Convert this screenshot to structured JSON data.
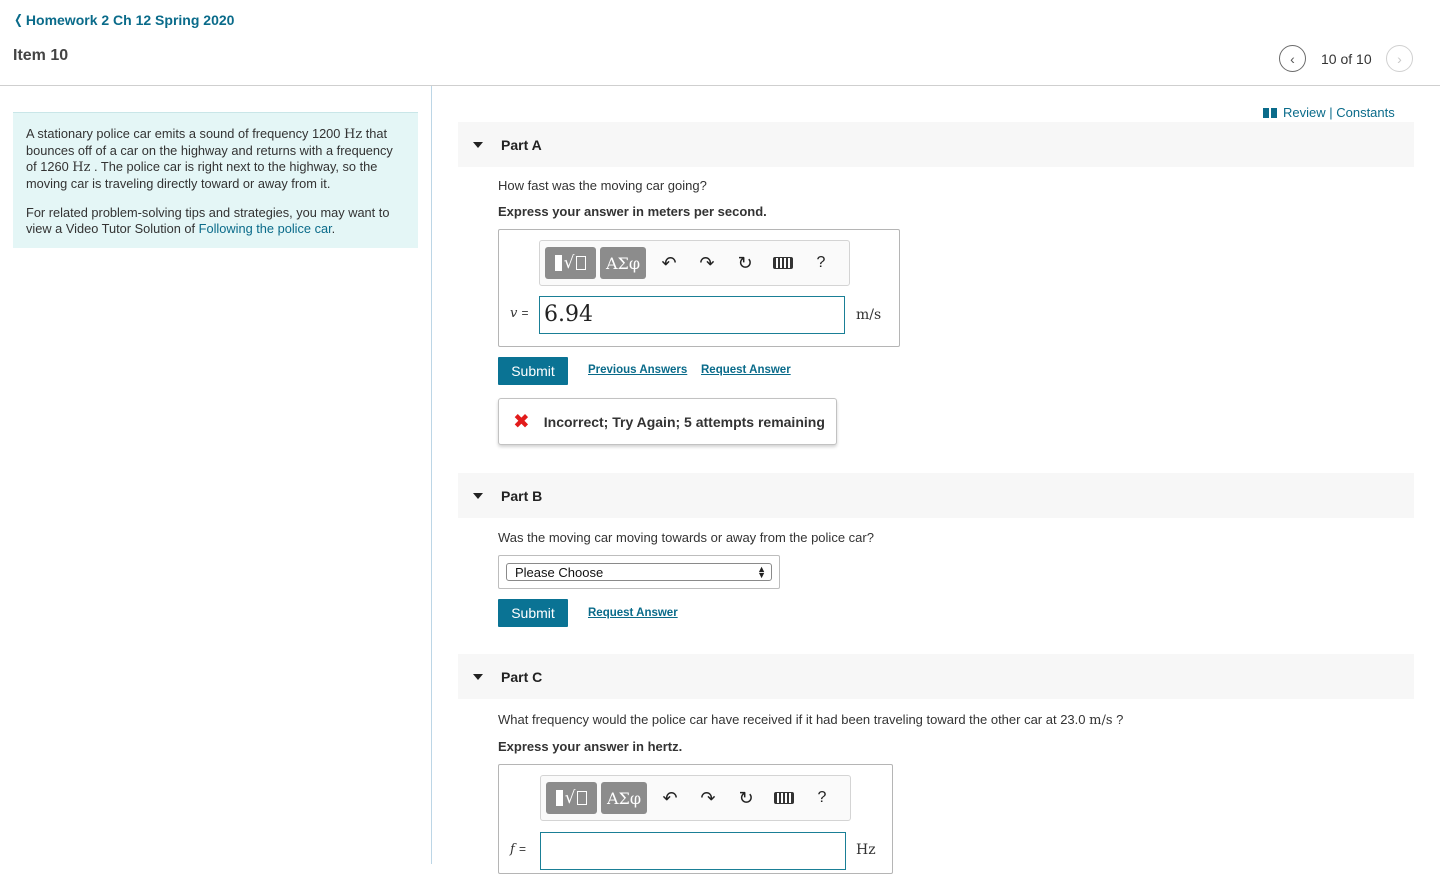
{
  "header": {
    "back_label": "Homework 2 Ch 12 Spring 2020",
    "item_title": "Item 10",
    "position": "10 of 10"
  },
  "intro": {
    "p1_a": "A stationary police car emits a sound of frequency 1200",
    "p1_hz1": "Hz",
    "p1_b": "that bounces off of a car on the highway and returns with a frequency of 1260",
    "p1_hz2": "Hz",
    "p1_c": ". The police car is right next to the highway, so the moving car is traveling directly toward or away from it.",
    "p2_a": "For related problem-solving tips and strategies, you may want to view a Video Tutor Solution of",
    "p2_link": "Following the police car",
    "p2_b": "."
  },
  "review_links": "Review | Constants",
  "toolbar": {
    "greek": "ΑΣφ",
    "help": "?"
  },
  "part_a": {
    "label": "Part A",
    "question": "How fast was the moving car going?",
    "instruction": "Express your answer in meters per second.",
    "var": "v",
    "eq": "=",
    "value": "6.94",
    "unit": "m/s",
    "submit": "Submit",
    "prev_answers": "Previous Answers",
    "request_answer": "Request Answer",
    "feedback": "Incorrect; Try Again; 5 attempts remaining"
  },
  "part_b": {
    "label": "Part B",
    "question": "Was the moving car moving towards or away from the police car?",
    "select_value": "Please Choose",
    "submit": "Submit",
    "request_answer": "Request Answer"
  },
  "part_c": {
    "label": "Part C",
    "question_a": "What frequency would the police car have received if it had been traveling toward the other car at 23.0",
    "question_unit": "m/s",
    "question_b": "?",
    "instruction": "Express your answer in hertz.",
    "var": "f",
    "eq": "=",
    "value": "",
    "unit": "Hz"
  },
  "colors": {
    "accent": "#0a7394",
    "link": "#0a6b8a",
    "intro_bg": "#e4f6f6",
    "error": "#e21b1b"
  }
}
